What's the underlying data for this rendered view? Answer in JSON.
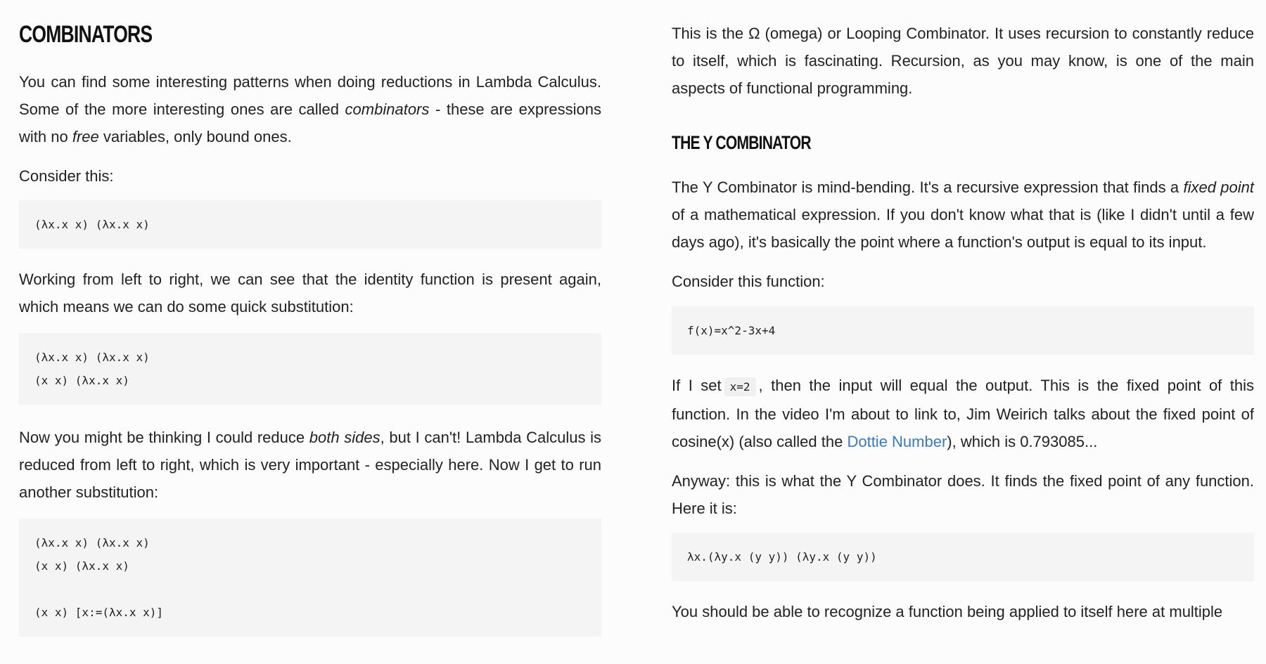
{
  "left": {
    "heading": "COMBINATORS",
    "p1": {
      "a": "You can find some interesting patterns when doing reductions in Lambda Calculus. Some of the more interesting ones are called ",
      "em1": "combinators",
      "b": " - these are expressions with no ",
      "em2": "free",
      "c": " variables, only bound ones."
    },
    "p2": "Consider this:",
    "code1": "(λx.x x) (λx.x x)",
    "p3": "Working from left to right, we can see that the identity function is present again, which means we can do some quick substitution:",
    "code2": "(λx.x x) (λx.x x)\n(x x) (λx.x x)",
    "p4": {
      "a": "Now you might be thinking I could reduce ",
      "em": "both sides",
      "b": ", but I can't! Lambda Calculus is reduced from left to right, which is very important - especially here. Now I get to run another substitution:"
    },
    "code3": "(λx.x x) (λx.x x)\n(x x) (λx.x x)\n\n(x x) [x:=(λx.x x)]"
  },
  "right": {
    "p1": "This is the Ω (omega) or Looping Combinator. It uses recursion to constantly reduce to itself, which is fascinating. Recursion, as you may know, is one of the main aspects of functional programming.",
    "heading": "THE Y COMBINATOR",
    "p2": {
      "a": "The Y Combinator is mind-bending. It's a recursive expression that finds a ",
      "em": "fixed point",
      "b": " of a mathematical expression. If you don't know what that is (like I didn't until a few days ago), it's basically the point where a function's output is equal to its input."
    },
    "p3": "Consider this function:",
    "code1": "f(x)=x^2-3x+4",
    "p4": {
      "a": "If I set",
      "code": "x=2",
      "b": ", then the input will equal the output. This is the fixed point of this function. In the video I'm about to link to, Jim Weirich talks about the fixed point of cosine(x) (also called the ",
      "link": "Dottie Number",
      "c": "), which is 0.793085..."
    },
    "p5": "Anyway: this is what the Y Combinator does. It finds the fixed point of any function. Here it is:",
    "code2": "λx.(λy.x (y y)) (λy.x (y y))",
    "p6": "You should be able to recognize a function being applied to itself here at multiple"
  },
  "colors": {
    "link": "#3a7bbf",
    "code_background": "#f4f4f4",
    "page_background": "#fcfcfc"
  }
}
